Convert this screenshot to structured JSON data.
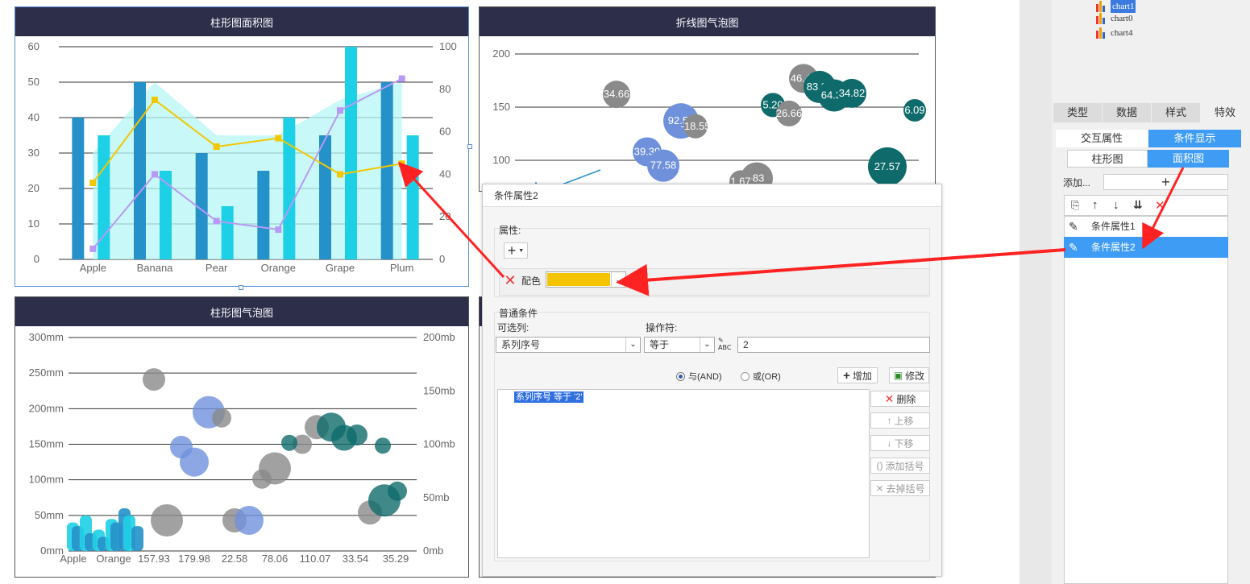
{
  "chart_data": [
    {
      "type": "bar",
      "title": "柱形图面积图",
      "categories": [
        "Apple",
        "Banana",
        "Pear",
        "Orange",
        "Grape",
        "Plum"
      ],
      "ylim_left": [
        0,
        60
      ],
      "ylim_right": [
        0,
        100
      ],
      "left_ticks": [
        "0",
        "10",
        "20",
        "30",
        "40",
        "50",
        "60"
      ],
      "right_ticks": [
        "0",
        "20",
        "40",
        "60",
        "80",
        "100"
      ],
      "series": [
        {
          "kind": "bar",
          "axis": "left",
          "color": "#2591c9",
          "values": [
            40,
            50,
            30,
            25,
            35,
            50
          ]
        },
        {
          "kind": "bar",
          "axis": "left",
          "color": "#1ed0e6",
          "values": [
            35,
            25,
            15,
            40,
            60,
            35
          ]
        },
        {
          "kind": "area",
          "axis": "left",
          "color": "#b6f5f5",
          "values": [
            30,
            50,
            35,
            35,
            45,
            50
          ]
        },
        {
          "kind": "line",
          "axis": "right",
          "color": "#f3c700",
          "values": [
            36,
            75,
            53,
            57,
            40,
            45
          ]
        },
        {
          "kind": "line",
          "axis": "right",
          "color": "#b899f5",
          "values": [
            5,
            40,
            18,
            14,
            70,
            85
          ]
        }
      ],
      "grid": true
    },
    {
      "type": "scatter",
      "title": "折线图气泡图",
      "ylim": [
        0,
        200
      ],
      "ticks": [
        "100",
        "150",
        "200"
      ],
      "points": [
        {
          "y": 162,
          "label": "34.66",
          "color": "#8a8a8a"
        },
        {
          "y": 177,
          "label": "46.43",
          "color": "#8a8a8a"
        },
        {
          "y": 169,
          "label": "83.37",
          "color": "#0f6b6b"
        },
        {
          "y": 161,
          "label": "64.34",
          "color": "#0f6b6b"
        },
        {
          "y": 163,
          "label": "34.82",
          "color": "#0f6b6b"
        },
        {
          "y": 152,
          "label": "5.20",
          "color": "#0f6b6b"
        },
        {
          "y": 144,
          "label": "26.66",
          "color": "#8a8a8a"
        },
        {
          "y": 147,
          "label": "6.09",
          "color": "#0f6b6b"
        },
        {
          "y": 137,
          "label": "92.53",
          "color": "#6f91dc"
        },
        {
          "y": 132,
          "label": "-18.55",
          "color": "#8a8a8a"
        },
        {
          "y": 108,
          "label": "39.39",
          "color": "#6f91dc"
        },
        {
          "y": 95,
          "label": "77.58",
          "color": "#6f91dc"
        },
        {
          "y": 83,
          "label": "-83",
          "color": "#8a8a8a"
        },
        {
          "y": 80,
          "label": "1.67",
          "color": "#8a8a8a"
        },
        {
          "y": 94,
          "label": "27.57",
          "color": "#0f6b6b"
        }
      ]
    },
    {
      "type": "scatter",
      "title": "柱形图气泡图",
      "left_ticks": [
        "0mm",
        "50mm",
        "100mm",
        "150mm",
        "200mm",
        "250mm",
        "300mm"
      ],
      "right_ticks": [
        "0mb",
        "50mb",
        "100mb",
        "150mb",
        "200mb"
      ],
      "x_ticks": [
        "Apple",
        "Orange",
        "157.93",
        "179.98",
        "22.58",
        "78.06",
        "110.07",
        "33.54",
        "35.29"
      ],
      "bars": [
        {
          "y": 40,
          "color": "#1ed0e6"
        },
        {
          "y": 35,
          "color": "#2591c9"
        },
        {
          "y": 50,
          "color": "#1ed0e6"
        },
        {
          "y": 25,
          "color": "#2591c9"
        },
        {
          "y": 30,
          "color": "#1ed0e6"
        },
        {
          "y": 20,
          "color": "#2591c9"
        },
        {
          "y": 45,
          "color": "#1ed0e6"
        },
        {
          "y": 40,
          "color": "#2591c9"
        },
        {
          "y": 60,
          "color": "#2591c9"
        },
        {
          "y": 50,
          "color": "#1ed0e6"
        },
        {
          "y": 35,
          "color": "#2591c9"
        }
      ],
      "bubbles": [
        {
          "y": 241,
          "r": 14,
          "color": "#8a8a8a"
        },
        {
          "y": 195,
          "r": 20,
          "color": "#6f91dc"
        },
        {
          "y": 187,
          "r": 12,
          "color": "#8a8a8a"
        },
        {
          "y": 146,
          "r": 14,
          "color": "#6f91dc"
        },
        {
          "y": 125,
          "r": 18,
          "color": "#6f91dc"
        },
        {
          "y": 43,
          "r": 20,
          "color": "#8a8a8a"
        },
        {
          "y": 43,
          "r": 15,
          "color": "#8a8a8a"
        },
        {
          "y": 43,
          "r": 18,
          "color": "#6f91dc"
        },
        {
          "y": 101,
          "r": 12,
          "color": "#8a8a8a"
        },
        {
          "y": 116,
          "r": 20,
          "color": "#8a8a8a"
        },
        {
          "y": 150,
          "r": 12,
          "color": "#8a8a8a"
        },
        {
          "y": 174,
          "r": 15,
          "color": "#8a8a8a"
        },
        {
          "y": 174,
          "r": 18,
          "color": "#0f6b6b"
        },
        {
          "y": 152,
          "r": 10,
          "color": "#0f6b6b"
        },
        {
          "y": 159,
          "r": 16,
          "color": "#0f6b6b"
        },
        {
          "y": 163,
          "r": 13,
          "color": "#0f6b6b"
        },
        {
          "y": 148,
          "r": 10,
          "color": "#0f6b6b"
        },
        {
          "y": 54,
          "r": 15,
          "color": "#8a8a8a"
        },
        {
          "y": 71,
          "r": 20,
          "color": "#0f6b6b"
        },
        {
          "y": 84,
          "r": 12,
          "color": "#0f6b6b"
        }
      ]
    }
  ],
  "dialog": {
    "title": "条件属性2",
    "attr_section": "属性:",
    "add_glyph": "+",
    "color_label": "配色",
    "color_value": "#f5c400",
    "normal_section": "普通条件",
    "column_label": "可选列:",
    "operator_label": "操作符:",
    "column_value": "系列序号",
    "operator_value": "等于",
    "value_input": "2",
    "and_label": "与(AND)",
    "or_label": "或(OR)",
    "add_button": "增加",
    "modify_button": "修改",
    "condition_text": "系列序号 等于 '2'",
    "delete_button": "删除",
    "up_button": "上移",
    "down_button": "下移",
    "add_bracket": "添加括号",
    "remove_bracket": "去掉括号"
  },
  "right_panel": {
    "tree": [
      "chart1",
      "chart0",
      "chart4"
    ],
    "tabs": [
      "类型",
      "数据",
      "样式",
      "特效"
    ],
    "seg1": [
      "交互属性",
      "条件显示"
    ],
    "seg2": [
      "柱形图",
      "面积图"
    ],
    "add_label": "添加...",
    "add_glyph": "+",
    "items": [
      "条件属性1",
      "条件属性2"
    ]
  }
}
